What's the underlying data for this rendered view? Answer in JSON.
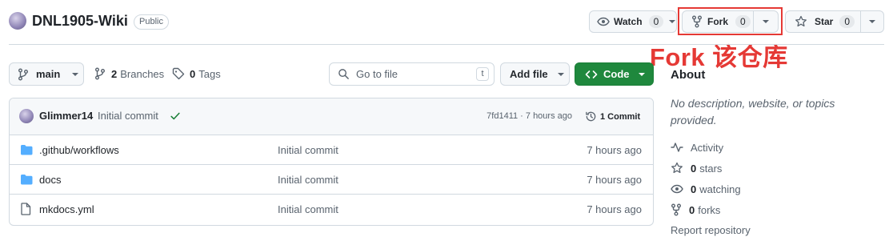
{
  "repo": {
    "name": "DNL1905-Wiki",
    "visibility": "Public"
  },
  "actions": {
    "watch_label": "Watch",
    "watch_count": "0",
    "fork_label": "Fork",
    "fork_count": "0",
    "star_label": "Star",
    "star_count": "0"
  },
  "annotation": {
    "text": "Fork 该仓库",
    "color": "#e53935"
  },
  "toolbar": {
    "branch": "main",
    "branches_count": "2",
    "branches_label": "Branches",
    "tags_count": "0",
    "tags_label": "Tags",
    "search_placeholder": "Go to file",
    "search_shortcut": "t",
    "add_file_label": "Add file",
    "code_label": "Code"
  },
  "latest_commit": {
    "author": "Glimmer14",
    "message": "Initial commit",
    "meta": "7fd1411 · 7 hours ago",
    "commits_label": "1 Commit"
  },
  "files": [
    {
      "name": ".github/workflows",
      "type": "folder",
      "message": "Initial commit",
      "time": "7 hours ago"
    },
    {
      "name": "docs",
      "type": "folder",
      "message": "Initial commit",
      "time": "7 hours ago"
    },
    {
      "name": "mkdocs.yml",
      "type": "file",
      "message": "Initial commit",
      "time": "7 hours ago"
    }
  ],
  "about": {
    "heading": "About",
    "description": "No description, website, or topics provided.",
    "activity_label": "Activity",
    "stars_count": "0",
    "stars_label": "stars",
    "watching_count": "0",
    "watching_label": "watching",
    "forks_count": "0",
    "forks_label": "forks",
    "report_label": "Report repository"
  },
  "colors": {
    "code_button": "#1f883d",
    "folder_icon": "#54aeff",
    "check": "#1a7f37",
    "highlight_box": "#e53935"
  }
}
